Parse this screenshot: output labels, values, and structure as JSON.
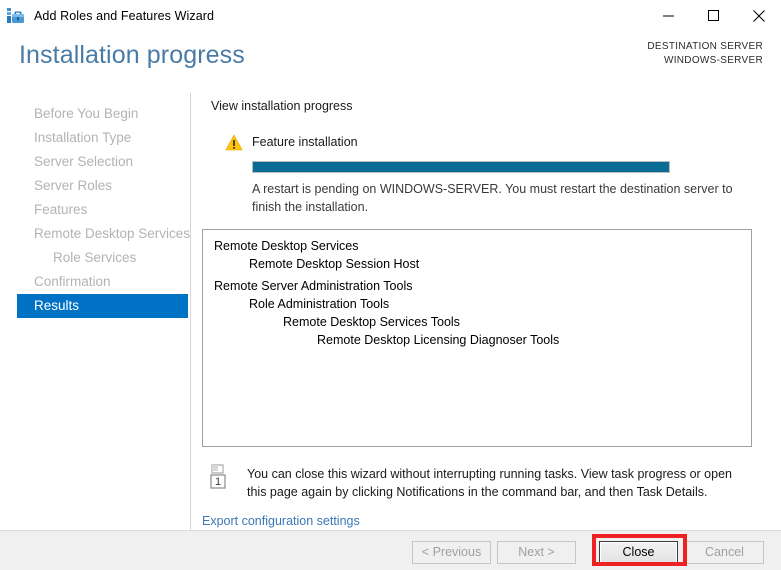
{
  "window": {
    "title": "Add Roles and Features Wizard",
    "icon": "server-toolbox-icon",
    "controls": {
      "minimize": "minimize-icon",
      "maximize": "maximize-icon",
      "close": "close-icon"
    }
  },
  "header": {
    "page_title": "Installation progress",
    "destination_server_label": "DESTINATION SERVER",
    "destination_server_name": "WINDOWS-SERVER",
    "accent_color": "#4a7ba7"
  },
  "sidebar": {
    "items": [
      {
        "label": "Before You Begin",
        "active": false,
        "sub": false
      },
      {
        "label": "Installation Type",
        "active": false,
        "sub": false
      },
      {
        "label": "Server Selection",
        "active": false,
        "sub": false
      },
      {
        "label": "Server Roles",
        "active": false,
        "sub": false
      },
      {
        "label": "Features",
        "active": false,
        "sub": false
      },
      {
        "label": "Remote Desktop Services",
        "active": false,
        "sub": false
      },
      {
        "label": "Role Services",
        "active": false,
        "sub": true
      },
      {
        "label": "Confirmation",
        "active": false,
        "sub": false
      },
      {
        "label": "Results",
        "active": true,
        "sub": false
      }
    ],
    "active_color": "#0072c6"
  },
  "main": {
    "section_caption": "View installation progress",
    "feature_label": "Feature installation",
    "warning_icon": "warning-triangle-icon",
    "progress": {
      "percent": 100,
      "fill_color": "#0a6b94"
    },
    "restart_text": "A restart is pending on WINDOWS-SERVER. You must restart the destination server to finish the installation.",
    "results": [
      {
        "text": "Remote Desktop Services",
        "level": 0
      },
      {
        "text": "Remote Desktop Session Host",
        "level": 1
      },
      {
        "text": "Remote Server Administration Tools",
        "level": 0
      },
      {
        "text": "Role Administration Tools",
        "level": 1
      },
      {
        "text": "Remote Desktop Services Tools",
        "level": 2
      },
      {
        "text": "Remote Desktop Licensing Diagnoser Tools",
        "level": 3
      }
    ],
    "notice_icon": "notification-flag-icon",
    "notice_badge": "1",
    "notice_text": "You can close this wizard without interrupting running tasks. View task progress or open this page again by clicking Notifications in the command bar, and then Task Details.",
    "export_link": "Export configuration settings"
  },
  "footer": {
    "previous_label": "< Previous",
    "next_label": "Next >",
    "close_label": "Close",
    "cancel_label": "Cancel",
    "highlight_color": "#ee2222"
  }
}
